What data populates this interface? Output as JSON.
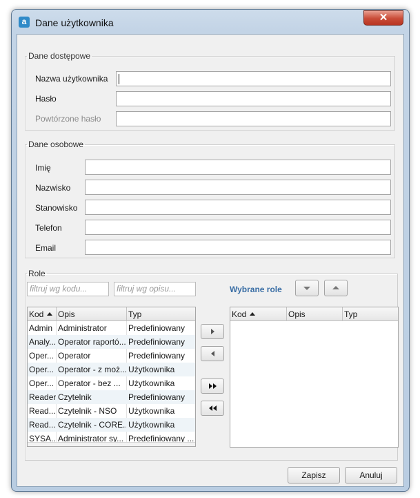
{
  "window": {
    "title": "Dane użytkownika",
    "app_icon_letter": "a",
    "close_glyph": "✕"
  },
  "access": {
    "legend": "Dane dostępowe",
    "username_label": "Nazwa użytkownika",
    "password_label": "Hasło",
    "password_repeat_label": "Powtórzone hasło",
    "username_value": "",
    "password_value": "",
    "password_repeat_value": ""
  },
  "personal": {
    "legend": "Dane osobowe",
    "first_name_label": "Imię",
    "last_name_label": "Nazwisko",
    "position_label": "Stanowisko",
    "phone_label": "Telefon",
    "email_label": "Email",
    "first_name_value": "",
    "last_name_value": "",
    "position_value": "",
    "phone_value": "",
    "email_value": ""
  },
  "roles": {
    "legend": "Role",
    "filter_code_placeholder": "filtruj wg kodu...",
    "filter_desc_placeholder": "filtruj wg opisu...",
    "selected_label": "Wybrane role",
    "columns": [
      "Kod",
      "Opis",
      "Typ"
    ],
    "available": [
      {
        "code": "Admin",
        "desc": "Administrator",
        "type": "Predefiniowany"
      },
      {
        "code": "Analy...",
        "desc": "Operator raportó...",
        "type": "Predefiniowany"
      },
      {
        "code": "Oper...",
        "desc": "Operator",
        "type": "Predefiniowany"
      },
      {
        "code": "Oper...",
        "desc": "Operator - z moż...",
        "type": "Użytkownika"
      },
      {
        "code": "Oper...",
        "desc": "Operator - bez ...",
        "type": "Użytkownika"
      },
      {
        "code": "Reader",
        "desc": "Czytelnik",
        "type": "Predefiniowany"
      },
      {
        "code": "Read...",
        "desc": "Czytelnik - NSO",
        "type": "Użytkownika"
      },
      {
        "code": "Read...",
        "desc": "Czytelnik - CORE...",
        "type": "Użytkownika"
      },
      {
        "code": "SYSA...",
        "desc": "Administrator sy...",
        "type": "Predefiniowany ..."
      }
    ],
    "selected": []
  },
  "footer": {
    "save_label": "Zapisz",
    "cancel_label": "Anuluj"
  },
  "colors": {
    "accent_link": "#3a6ea5",
    "row_alt": "#eef4f8",
    "close_red": "#c94b37"
  }
}
